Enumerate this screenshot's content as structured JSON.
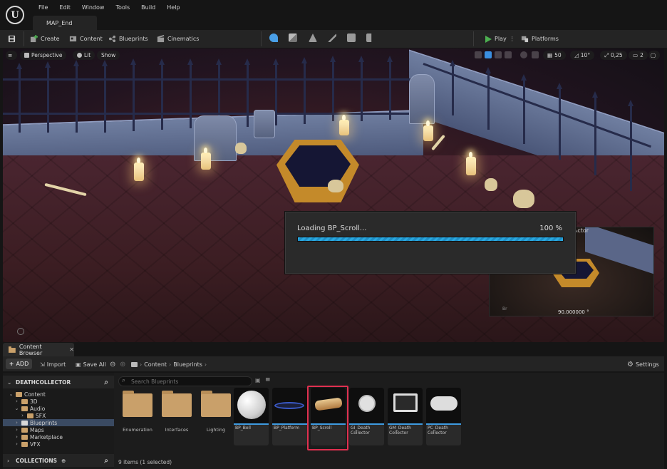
{
  "app": {
    "logo_label": "U",
    "menu": [
      "File",
      "Edit",
      "Window",
      "Tools",
      "Build",
      "Help"
    ],
    "map_tab": "MAP_End"
  },
  "toolbar": {
    "create": "Create",
    "content": "Content",
    "blueprints": "Blueprints",
    "cinematics": "Cinematics",
    "play": "Play",
    "platforms": "Platforms"
  },
  "viewport": {
    "perspective": "Perspective",
    "lit": "Lit",
    "show": "Show",
    "grid_snap": "50",
    "rotation_snap": "10°",
    "scale_snap": "0,25",
    "camera_speed": "2"
  },
  "preview": {
    "title": "Actor",
    "rotation_value": "90.000000 °",
    "small_label": "Br"
  },
  "loading": {
    "text": "Loading BP_Scroll...",
    "percent_label": "100 %",
    "progress": 1.0
  },
  "content_browser": {
    "tab": "Content Browser",
    "add": "ADD",
    "import": "Import",
    "save_all": "Save All",
    "breadcrumb": [
      "Content",
      "Blueprints"
    ],
    "settings": "Settings",
    "sources_header": "DEATHCOLLECTOR",
    "tree": [
      {
        "label": "Content",
        "indent": 0,
        "expanded": true,
        "selected": false
      },
      {
        "label": "3D",
        "indent": 1,
        "expanded": false,
        "selected": false
      },
      {
        "label": "Audio",
        "indent": 1,
        "expanded": true,
        "selected": false
      },
      {
        "label": "SFX",
        "indent": 2,
        "expanded": false,
        "selected": false
      },
      {
        "label": "Blueprints",
        "indent": 1,
        "expanded": false,
        "selected": true
      },
      {
        "label": "Maps",
        "indent": 1,
        "expanded": false,
        "selected": false
      },
      {
        "label": "Marketplace",
        "indent": 1,
        "expanded": false,
        "selected": false
      },
      {
        "label": "VFX",
        "indent": 1,
        "expanded": false,
        "selected": false
      }
    ],
    "collections": "COLLECTIONS",
    "search_placeholder": "Search Blueprints",
    "folders": [
      "Enumeration",
      "Interfaces",
      "Lighting"
    ],
    "assets": [
      {
        "name": "BP_Bell",
        "thumb": "sphere"
      },
      {
        "name": "BP_Platform",
        "thumb": "platform"
      },
      {
        "name": "BP_Scroll",
        "thumb": "scroll",
        "selected": true
      },
      {
        "name": "GI_Death\nCollector",
        "thumb": "cube"
      },
      {
        "name": "GM_Death\nCollector",
        "thumb": "monitor"
      },
      {
        "name": "PC_Death\nCollector",
        "thumb": "gamepad"
      }
    ],
    "item_count": "9 items (1 selected)"
  },
  "colors": {
    "accent_blue": "#2aa9e0",
    "selection_red": "#e03050",
    "play_green": "#4caf50",
    "folder_tan": "#c9a06a"
  }
}
